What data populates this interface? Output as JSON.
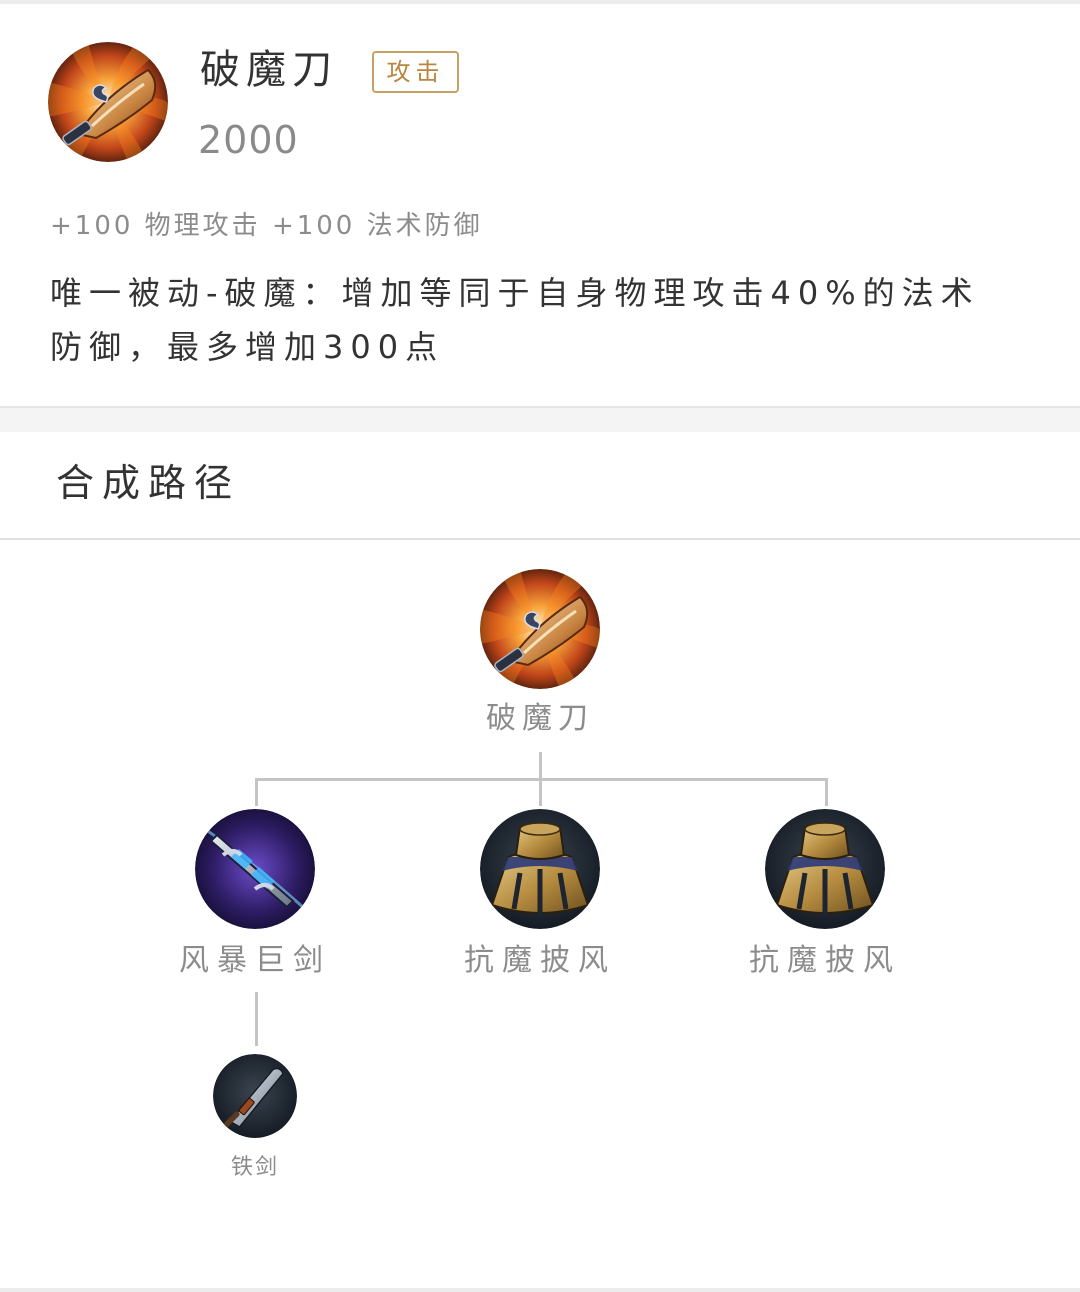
{
  "item": {
    "name": "破魔刀",
    "type_badge": "攻击",
    "price": "2000",
    "stats": "+100 物理攻击 +100 法术防御",
    "description": "唯一被动-破魔：增加等同于自身物理攻击40%的法术防御，最多增加300点",
    "icon": "blade-icon"
  },
  "recipe": {
    "section_title": "合成路径",
    "root": {
      "name": "破魔刀",
      "icon": "blade-icon"
    },
    "components": [
      {
        "name": "风暴巨剑",
        "icon": "storm-sword-icon"
      },
      {
        "name": "抗魔披风",
        "icon": "cloak-icon"
      },
      {
        "name": "抗魔披风",
        "icon": "cloak-icon"
      }
    ],
    "sub_components": [
      {
        "name": "铁剑",
        "icon": "iron-sword-icon"
      }
    ]
  },
  "colors": {
    "badge_border": "#c8a066",
    "badge_text": "#b8863e",
    "tree_line": "#c4c4c4",
    "muted_text": "#8c8c8c"
  }
}
